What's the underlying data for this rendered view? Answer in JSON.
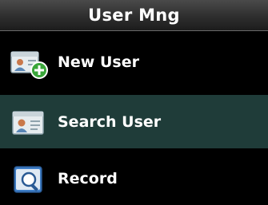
{
  "header": {
    "title": "User Mng"
  },
  "menu": {
    "selected_index": 1,
    "items": [
      {
        "label": "New User",
        "icon": "add-user-icon"
      },
      {
        "label": "Search User",
        "icon": "search-user-icon"
      },
      {
        "label": "Record",
        "icon": "record-icon"
      }
    ]
  },
  "colors": {
    "background": "#000000",
    "selected_row": "#1f3c39",
    "title_bar": "#2e2e2e",
    "text": "#ffffff",
    "add_badge": "#3aa63a"
  }
}
